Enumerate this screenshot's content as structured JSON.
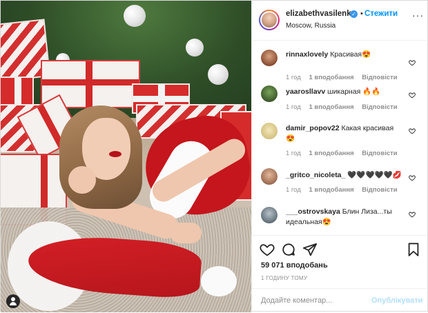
{
  "post": {
    "photo_alt_icon": "user-tag-icon",
    "header": {
      "username": "elizabethvasilenko",
      "verified_icon": "verified-badge-icon",
      "separator": "•",
      "follow_label": "Стежити",
      "location": "Moscow, Russia",
      "more_icon": "more-options-icon",
      "more_glyph": "···"
    },
    "comments": [
      {
        "username": "rinnaxlovely",
        "text": "Красивая😍",
        "time": "1 год",
        "likes": "1 вподобання",
        "reply": "Відповісти"
      },
      {
        "username": "yaarosllavv",
        "text": "шикарная 🔥🔥",
        "time": "1 год",
        "likes": "1 вподобання",
        "reply": "Відповісти"
      },
      {
        "username": "damir_popov22",
        "text": "Какая красивая 😍",
        "time": "1 год",
        "likes": "1 вподобання",
        "reply": "Відповісти"
      },
      {
        "username": "_gritco_nicoleta_",
        "text": "🖤🖤🖤🖤🖤💋",
        "time": "1 год",
        "likes": "1 вподобання",
        "reply": "Відповісти"
      },
      {
        "username": "___ostrovskaya",
        "text": "Блин Лиза...ты идеальная😍",
        "time": "",
        "likes": "",
        "reply": ""
      }
    ],
    "actions": {
      "like_icon": "heart-icon",
      "comment_icon": "comment-icon",
      "share_icon": "share-icon",
      "save_icon": "bookmark-icon"
    },
    "likes_count": "59 071 вподобань",
    "timestamp": "1 ГОДИНУ ТОМУ",
    "add_comment": {
      "placeholder": "Додайте коментар...",
      "publish_label": "Опублікувати"
    },
    "colors": {
      "accent": "#0095f6",
      "publish_disabled": "#b2dffc",
      "meta_grey": "#8e8e8e",
      "text": "#262626"
    }
  }
}
